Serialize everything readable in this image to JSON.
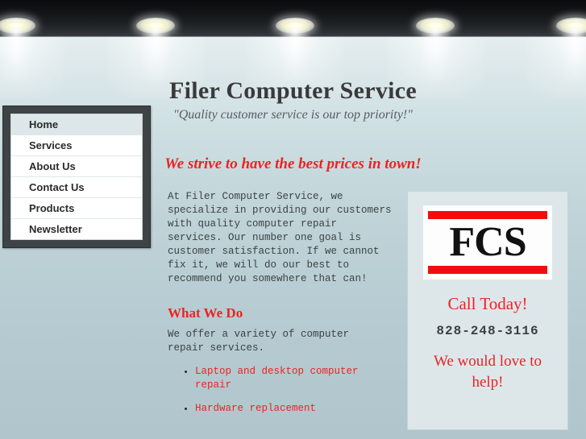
{
  "header": {
    "site_title": "Filer Computer Service",
    "tagline": "\"Quality customer service is our top priority!\"",
    "slogan": "We strive to have the best prices in town!",
    "ceiling_lights": [
      20,
      193,
      366,
      540,
      714
    ],
    "dark_band_color": "#14171a"
  },
  "nav": {
    "items": [
      {
        "label": "Home",
        "active": true
      },
      {
        "label": "Services",
        "active": false
      },
      {
        "label": "About Us",
        "active": false
      },
      {
        "label": "Contact Us",
        "active": false
      },
      {
        "label": "Products",
        "active": false
      },
      {
        "label": "Newsletter",
        "active": false
      }
    ]
  },
  "main": {
    "intro": "At Filer Computer Service, we\nspecialize in providing our customers\nwith quality computer repair\nservices.  Our number one goal is\ncustomer satisfaction.  If we cannot\nfix it, we will do our best to\nrecommend you somewhere that can!",
    "section_heading": "What We Do",
    "offer_text": "We offer a variety of computer\nrepair services.",
    "services": [
      "Laptop and desktop computer repair",
      "Hardware replacement"
    ]
  },
  "sidebar": {
    "logo_text": "FCS",
    "call_today": "Call Today!",
    "phone": "828-248-3116",
    "love_to_help": "We would love to help!"
  },
  "colors": {
    "accent_red": "#ee2222",
    "page_bg_top": "#f2f7f8",
    "page_bg_bottom": "#b0c6cc",
    "nav_frame": "#3e4346",
    "nav_active": "#dde7e9",
    "sidebar_bg": "#dde7ea"
  }
}
